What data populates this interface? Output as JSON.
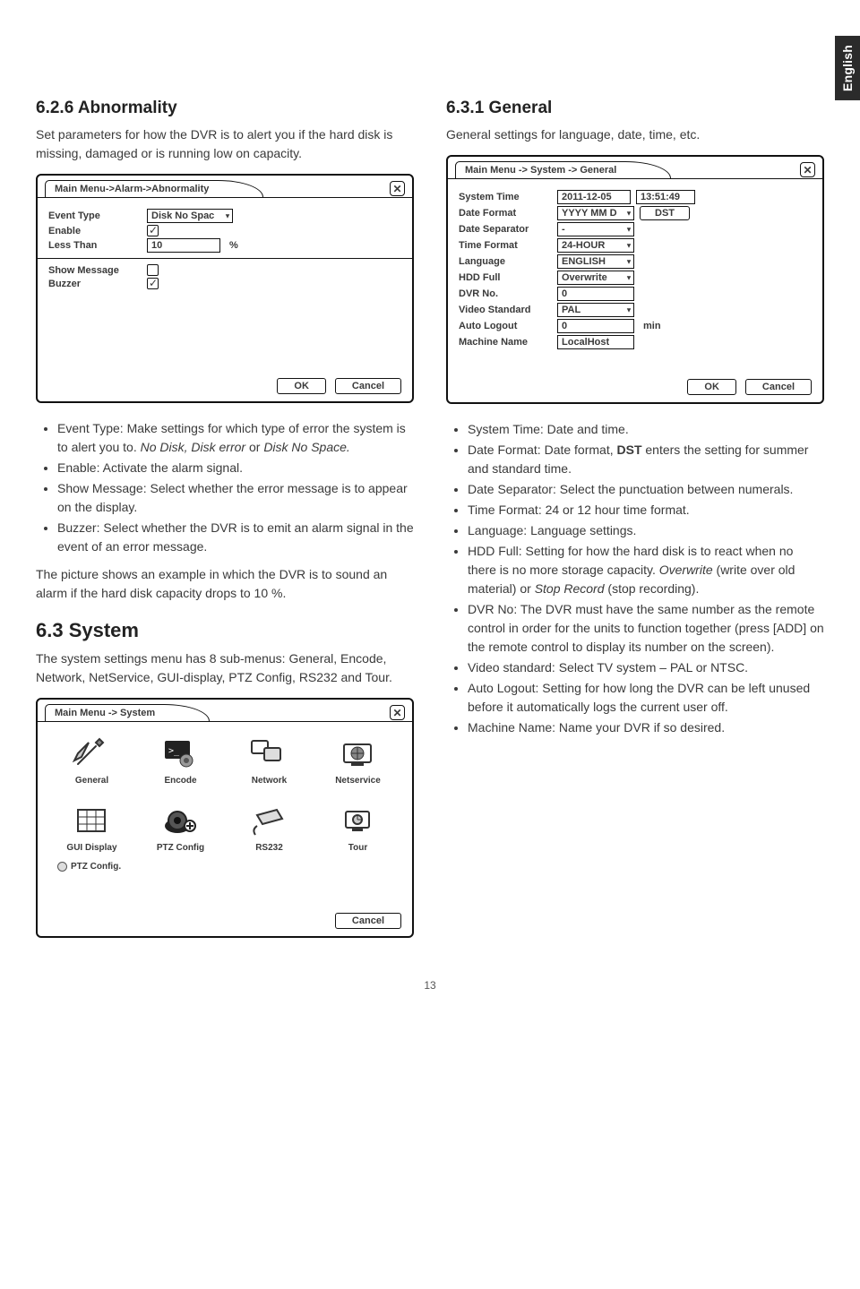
{
  "lang_tab": "English",
  "page_number": "13",
  "left": {
    "h_abnormality": "6.2.6 Abnormality",
    "p_abnormality": "Set parameters for how the DVR is to alert you if the hard disk is missing, damaged or is running low on capacity.",
    "win_ab_title": "Main Menu->Alarm->Abnormality",
    "fields_ab": {
      "event_type_label": "Event Type",
      "event_type_value": "Disk No Spac",
      "enable_label": "Enable",
      "less_than_label": "Less Than",
      "less_than_value": "10",
      "less_than_unit": "%",
      "show_message_label": "Show Message",
      "buzzer_label": "Buzzer"
    },
    "ok_label": "OK",
    "cancel_label": "Cancel",
    "bullets_ab": {
      "b1a": "Event Type: Make settings for which type of error the system is to alert you to. ",
      "b1b": "No Disk, Disk error",
      "b1c": " or ",
      "b1d": "Disk No Space.",
      "b2": "Enable: Activate the alarm signal.",
      "b3": "Show Message: Select whether the error message is to appear on the display.",
      "b4": "Buzzer: Select whether the DVR is to emit an alarm signal in the event of an error message."
    },
    "p_example": "The picture shows an example in which the DVR is to sound an alarm if the hard disk capacity drops to 10 %.",
    "h_system": "6.3 System",
    "p_system": "The system settings menu has 8 sub-menus: General, Encode, Network, NetService, GUI-display, PTZ Config, RS232 and Tour.",
    "win_sys_title": "Main Menu -> System",
    "sys_icons": [
      "General",
      "Encode",
      "Network",
      "Netservice",
      "GUI Display",
      "PTZ Config",
      "RS232",
      "Tour"
    ],
    "tip": "PTZ Config."
  },
  "right": {
    "h_general": "6.3.1 General",
    "p_general": "General settings for language, date, time, etc.",
    "win_gen_title": "Main Menu -> System -> General",
    "fields_gen": {
      "system_time_label": "System Time",
      "system_time_date": "2011-12-05",
      "system_time_time": "13:51:49",
      "date_format_label": "Date Format",
      "date_format_value": "YYYY MM D",
      "dst_label": "DST",
      "date_separator_label": "Date Separator",
      "date_separator_value": "-",
      "time_format_label": "Time Format",
      "time_format_value": "24-HOUR",
      "language_label": "Language",
      "language_value": "ENGLISH",
      "hdd_full_label": "HDD Full",
      "hdd_full_value": "Overwrite",
      "dvr_no_label": "DVR No.",
      "dvr_no_value": "0",
      "video_standard_label": "Video Standard",
      "video_standard_value": "PAL",
      "auto_logout_label": "Auto Logout",
      "auto_logout_value": "0",
      "auto_logout_unit": "min",
      "machine_name_label": "Machine Name",
      "machine_name_value": "LocalHost"
    },
    "bullets_gen": {
      "b1": "System Time: Date and time.",
      "b2a": "Date Format: Date format, ",
      "b2b": "DST",
      "b2c": " enters the setting for summer and standard time.",
      "b3": "Date Separator: Select the punctuation between numerals.",
      "b4": "Time Format: 24 or 12 hour time format.",
      "b5": "Language: Language settings.",
      "b6a": "HDD Full: Setting for how the hard disk is to react when no there is no more storage capacity. ",
      "b6b": "Overwrite",
      "b6c": " (write over old material) or ",
      "b6d": "Stop Record",
      "b6e": " (stop recording).",
      "b7": "DVR No: The DVR must have the same number as the remote control in order for the units to function together (press [ADD] on the remote control to display its number on the screen).",
      "b8": "Video standard: Select TV system – PAL or NTSC.",
      "b9": "Auto Logout: Setting for how long the DVR can be left unused before it automatically logs the current user off.",
      "b10": "Machine Name: Name your DVR if so desired."
    }
  }
}
